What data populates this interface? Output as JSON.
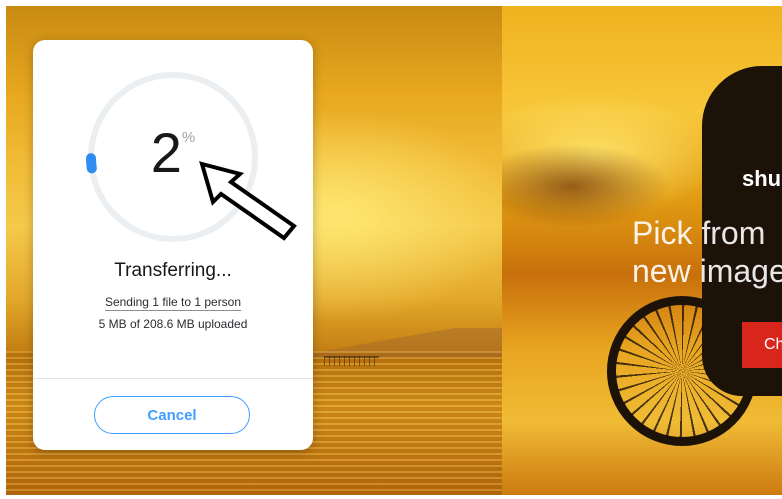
{
  "transfer": {
    "progress_percent": 2,
    "percent_value": "2",
    "percent_sign": "%",
    "status_title": "Transferring...",
    "sending_text": "Sending 1 file to 1 person",
    "uploaded_text": "5 MB of 208.6 MB uploaded",
    "cancel_label": "Cancel"
  },
  "promo": {
    "brand_partial": "shu",
    "tagline_line1": "Pick from",
    "tagline_line2": "new image",
    "cta_partial": "Ch"
  },
  "colors": {
    "accent": "#409fff",
    "ring_track": "#eceff1",
    "progress_dot": "#2f8cf0",
    "cta": "#d8261c"
  },
  "icons": {
    "annotation": "hollow-arrow-icon"
  }
}
